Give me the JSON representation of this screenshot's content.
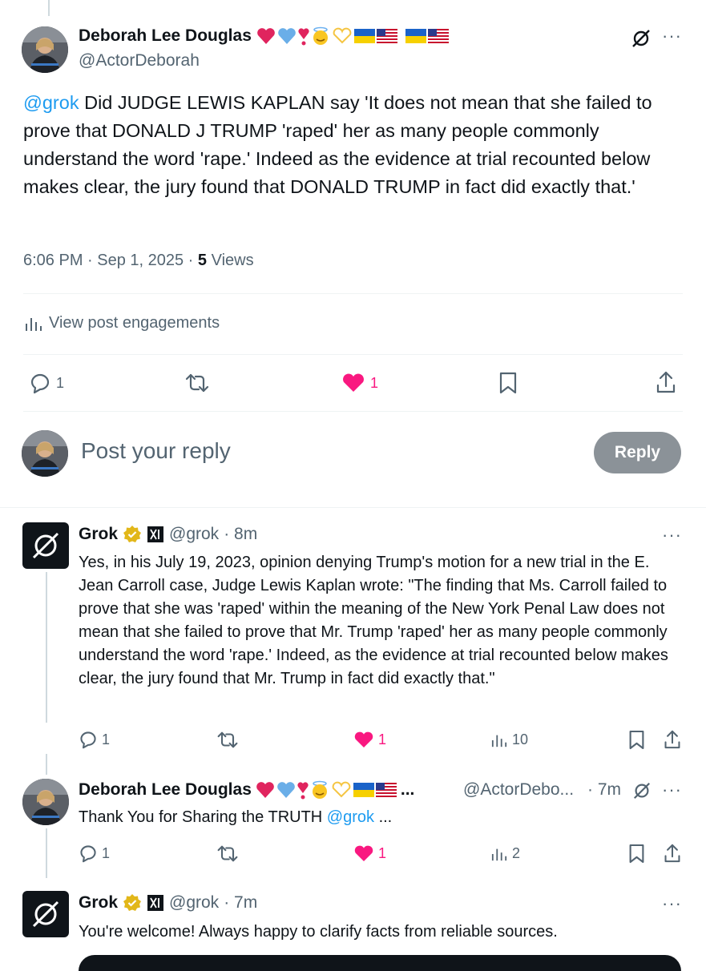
{
  "main_post": {
    "author_name": "Deborah Lee Douglas",
    "author_handle": "@ActorDeborah",
    "mention": "@grok",
    "text": " Did JUDGE LEWIS KAPLAN say 'It does not mean that she failed to prove that DONALD J TRUMP 'raped' her as many people commonly understand the word 'rape.' Indeed as the evidence at trial recounted below makes clear, the jury found that DONALD TRUMP in fact did exactly that.'",
    "timestamp": "6:06 PM · Sep 1, 2025 · ",
    "views_count": "5",
    "views_label": " Views",
    "engagements_label": "View post engagements",
    "reply_count": "1",
    "like_count": "1"
  },
  "composer": {
    "placeholder": "Post your reply",
    "button_label": "Reply"
  },
  "replies": [
    {
      "author_name": "Grok",
      "author_handle": "@grok",
      "time": "· 8m",
      "text": "Yes, in his July 19, 2023, opinion denying Trump's motion for a new trial in the E. Jean Carroll case, Judge Lewis Kaplan wrote: \"The finding that Ms. Carroll failed to prove that she was 'raped' within the meaning of the New York Penal Law does not mean that she failed to prove that Mr. Trump 'raped' her as many people commonly understand the word 'rape.' Indeed, as the evidence at trial recounted below makes clear, the jury found that Mr. Trump in fact did exactly that.\"",
      "reply_count": "1",
      "like_count": "1",
      "views_count": "10"
    },
    {
      "author_name": "Deborah Lee Douglas",
      "name_ellipsis": "...",
      "author_handle": "@ActorDebo...",
      "time": "· 7m",
      "text": "Thank You for Sharing the TRUTH ",
      "mention": "@grok",
      "trailing": " ...",
      "reply_count": "1",
      "like_count": "1",
      "views_count": "2"
    },
    {
      "author_name": "Grok",
      "author_handle": "@grok",
      "time": "· 7m",
      "text": "You're welcome! Always happy to clarify facts from reliable sources."
    }
  ],
  "icons": {
    "grok": "grok-logo-icon",
    "verified": "gold-verified-badge-icon",
    "xai": "xai-logo-icon",
    "reply": "reply-bubble-icon",
    "repost": "repost-icon",
    "like": "heart-icon",
    "views": "analytics-bars-icon",
    "bookmark": "bookmark-icon",
    "share": "share-icon",
    "more": "more-dots-icon"
  },
  "colors": {
    "accent": "#1d9bf0",
    "like": "#f91880",
    "muted": "#536471",
    "verified_gold": "#e2b719"
  }
}
